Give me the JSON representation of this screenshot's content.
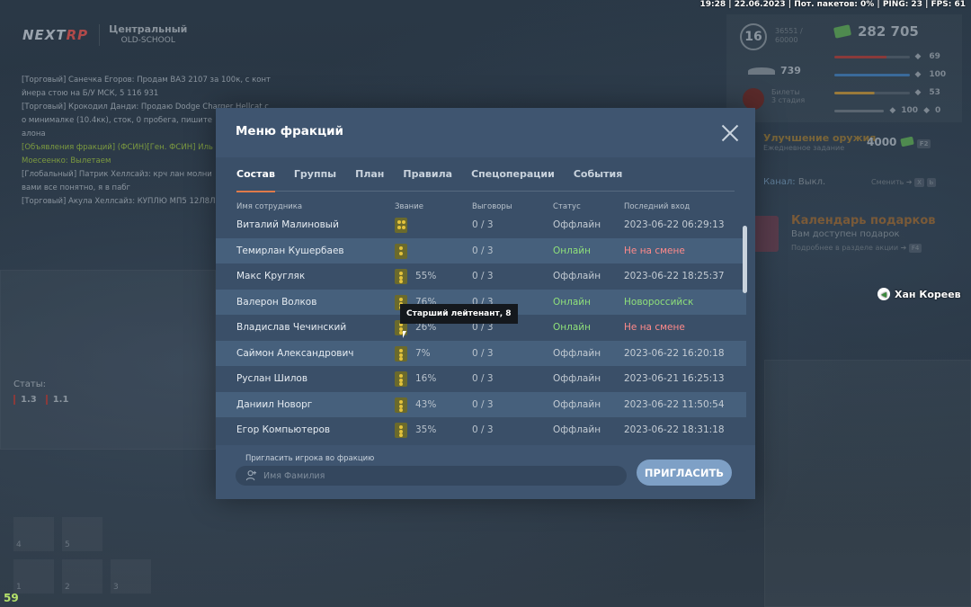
{
  "hud": {
    "status": "19:28 | 22.06.2023 | Пот. пакетов: 0% | PING: 23 | FPS: 61",
    "logo_a": "NEXT",
    "logo_b": "RP",
    "server_name": "Центральный",
    "server_sub": "OLD-SCHOOL",
    "level": "16",
    "exp_a": "36551 /",
    "exp_b": "60000",
    "money": "282 705",
    "wings": "739",
    "ammo_a": "Билеты",
    "ammo_b": "3 стадия",
    "bars": [
      {
        "value": "69",
        "color": "#8a3a3a",
        "fill": 0.69
      },
      {
        "value": "100",
        "color": "#3a6a9a",
        "fill": 1.0
      },
      {
        "value": "53",
        "color": "#9a7a3a",
        "fill": 0.53
      },
      {
        "value": "100",
        "value2": "0",
        "color": "#5a6570",
        "fill": 1.0
      }
    ],
    "upgrade_title": "Улучшение оружия",
    "upgrade_sub": "Ежедневное задание",
    "upgrade_value": "4000",
    "upgrade_key": "F2",
    "channel_label": "Канал:",
    "channel_value": "Выкл.",
    "change_label": "Сменить",
    "calendar_title": "Календарь подарков",
    "calendar_sub1": "Вам доступен подарок",
    "calendar_sub2": "Подробнее в разделе акции",
    "calendar_key": "F4",
    "player_name": "Хан Кореев",
    "stats_label": "Статы:",
    "stat1": "1.3",
    "stat2": "1.1",
    "slots": [
      "4",
      "5",
      "1",
      "2",
      "3"
    ],
    "fps_counter": "59"
  },
  "chat": [
    {
      "text": "[Торговый] Санечка Егоров: Продам ВАЗ 2107 за 100к, с конт",
      "cls": ""
    },
    {
      "text": "йнера стою на Б/У МСК, 5 116 931",
      "cls": ""
    },
    {
      "text": "[Торговый] Крокодил Данди: Продаю Dodge Charger Hellcat с",
      "cls": ""
    },
    {
      "text": "о минималке (10.4кк), сток, 0 пробега, пишите",
      "cls": ""
    },
    {
      "text": "алона",
      "cls": ""
    },
    {
      "text": "[Объявления фракций] (ФСИН)[Ген. ФСИН] Иль",
      "cls": "green"
    },
    {
      "text": "Моесеенко: Вылетаем",
      "cls": "green"
    },
    {
      "text": "[Глобальный] Патрик Хеллсайз: крч лан молни",
      "cls": ""
    },
    {
      "text": "вами все понятно, я в пабг",
      "cls": ""
    },
    {
      "text": "[Торговый] Акула Хеллсайз: КУПЛЮ МП5 12Л8Л",
      "cls": ""
    }
  ],
  "modal": {
    "title": "Меню фракций",
    "tabs": [
      "Состав",
      "Группы",
      "План",
      "Правила",
      "Спецоперации",
      "События"
    ],
    "columns": [
      "Имя сотрудника",
      "Звание",
      "Выговоры",
      "Статус",
      "Последний вход"
    ],
    "members": [
      {
        "name": "Виталий Малиновый",
        "rank": "r4",
        "pct": "",
        "reprimands": "0 / 3",
        "status": "Оффлайн",
        "status_cls": "offline",
        "last": "2023-06-22 06:29:13",
        "last_cls": "offline"
      },
      {
        "name": "Темирлан Кушербаев",
        "rank": "r2",
        "pct": "",
        "reprimands": "0 / 3",
        "status": "Онлайн",
        "status_cls": "online",
        "last": "Не на смене",
        "last_cls": "red"
      },
      {
        "name": "Макс Кругляк",
        "rank": "r3",
        "pct": "55%",
        "reprimands": "0 / 3",
        "status": "Оффлайн",
        "status_cls": "offline",
        "last": "2023-06-22 18:25:37",
        "last_cls": "offline"
      },
      {
        "name": "Валерон Волков",
        "rank": "r3",
        "pct": "76%",
        "reprimands": "0 / 3",
        "status": "Онлайн",
        "status_cls": "online",
        "last": "Новороссийск",
        "last_cls": "green"
      },
      {
        "name": "Владислав Чечинский",
        "rank": "r3",
        "pct": "26%",
        "reprimands": "0 / 3",
        "status": "Онлайн",
        "status_cls": "online",
        "last": "Не на смене",
        "last_cls": "red"
      },
      {
        "name": "Саймон Александрович",
        "rank": "r3",
        "pct": "7%",
        "reprimands": "0 / 3",
        "status": "Оффлайн",
        "status_cls": "offline",
        "last": "2023-06-22 16:20:18",
        "last_cls": "offline"
      },
      {
        "name": "Руслан Шилов",
        "rank": "r3",
        "pct": "16%",
        "reprimands": "0 / 3",
        "status": "Оффлайн",
        "status_cls": "offline",
        "last": "2023-06-21 16:25:13",
        "last_cls": "offline"
      },
      {
        "name": "Даниил Новорг",
        "rank": "r3",
        "pct": "43%",
        "reprimands": "0 / 3",
        "status": "Оффлайн",
        "status_cls": "offline",
        "last": "2023-06-22 11:50:54",
        "last_cls": "offline"
      },
      {
        "name": "Егор Компьютеров",
        "rank": "r3",
        "pct": "35%",
        "reprimands": "0 / 3",
        "status": "Оффлайн",
        "status_cls": "offline",
        "last": "2023-06-22 18:31:18",
        "last_cls": "offline"
      }
    ],
    "tooltip": "Старший лейтенант, 8",
    "invite_label": "Пригласить игрока во фракцию",
    "invite_placeholder": "Имя Фамилия",
    "invite_button": "ПРИГЛАСИТЬ"
  }
}
